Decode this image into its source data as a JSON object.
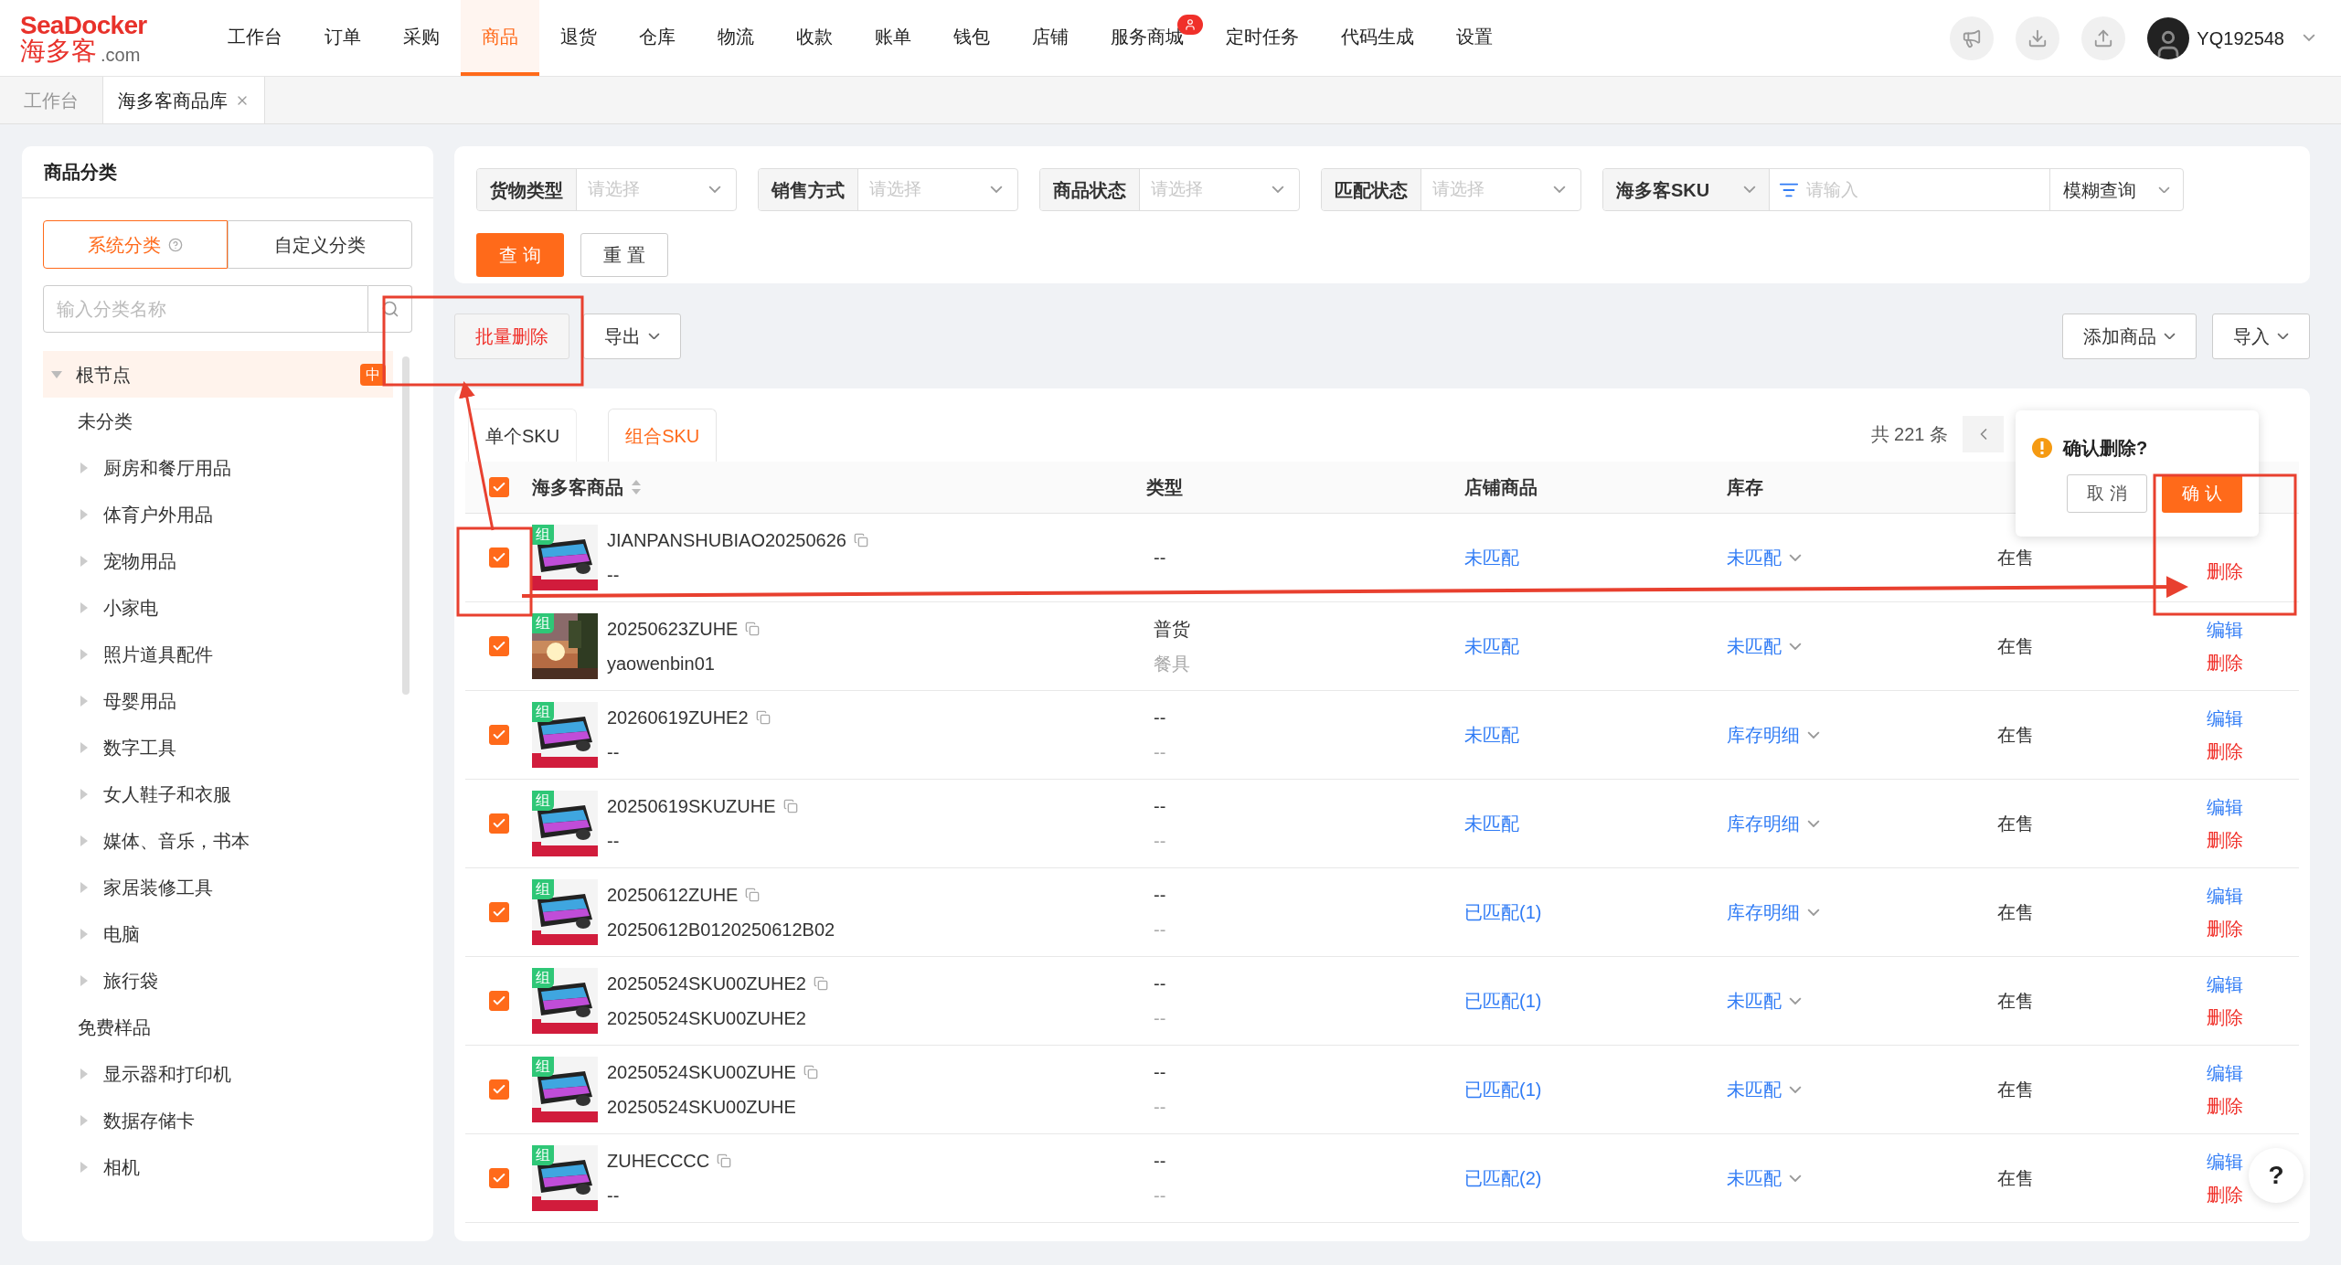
{
  "header": {
    "logo": {
      "brand": "SeaDocker",
      "name": "海多客",
      "suffix": ".com"
    },
    "nav": [
      {
        "label": "工作台",
        "selected": false
      },
      {
        "label": "订单",
        "selected": false
      },
      {
        "label": "采购",
        "selected": false
      },
      {
        "label": "商品",
        "selected": true
      },
      {
        "label": "退货",
        "selected": false
      },
      {
        "label": "仓库",
        "selected": false
      },
      {
        "label": "物流",
        "selected": false
      },
      {
        "label": "收款",
        "selected": false
      },
      {
        "label": "账单",
        "selected": false
      },
      {
        "label": "钱包",
        "selected": false
      },
      {
        "label": "店铺",
        "selected": false
      },
      {
        "label": "服务商城",
        "selected": false,
        "badge": true
      },
      {
        "label": "定时任务",
        "selected": false
      },
      {
        "label": "代码生成",
        "selected": false
      },
      {
        "label": "设置",
        "selected": false
      }
    ],
    "user": "YQ192548"
  },
  "page_tabs": [
    {
      "label": "工作台",
      "selected": false,
      "closable": false
    },
    {
      "label": "海多客商品库",
      "selected": true,
      "closable": true
    }
  ],
  "sidebar": {
    "title": "商品分类",
    "toggle": [
      {
        "label": "系统分类",
        "selected": true,
        "help": true
      },
      {
        "label": "自定义分类",
        "selected": false,
        "help": false
      }
    ],
    "search": {
      "placeholder": "输入分类名称"
    },
    "tree": [
      {
        "label": "根节点",
        "kind": "folder",
        "expanded": true,
        "selected": true,
        "badge": "中",
        "children": [
          {
            "label": "未分类",
            "kind": "leaf",
            "selected": false
          },
          {
            "label": "厨房和餐厅用品",
            "kind": "folder",
            "expanded": false,
            "selected": false
          },
          {
            "label": "体育户外用品",
            "kind": "folder",
            "expanded": false,
            "selected": false
          },
          {
            "label": "宠物用品",
            "kind": "folder",
            "expanded": false,
            "selected": false
          },
          {
            "label": "小家电",
            "kind": "folder",
            "expanded": false,
            "selected": false
          },
          {
            "label": "照片道具配件",
            "kind": "folder",
            "expanded": false,
            "selected": false
          },
          {
            "label": "母婴用品",
            "kind": "folder",
            "expanded": false,
            "selected": false
          },
          {
            "label": "数字工具",
            "kind": "folder",
            "expanded": false,
            "selected": false
          },
          {
            "label": "女人鞋子和衣服",
            "kind": "folder",
            "expanded": false,
            "selected": false
          },
          {
            "label": "媒体、音乐，书本",
            "kind": "folder",
            "expanded": false,
            "selected": false
          },
          {
            "label": "家居装修工具",
            "kind": "folder",
            "expanded": false,
            "selected": false
          },
          {
            "label": "电脑",
            "kind": "folder",
            "expanded": false,
            "selected": false
          },
          {
            "label": "旅行袋",
            "kind": "folder",
            "expanded": false,
            "selected": false
          },
          {
            "label": "免费样品",
            "kind": "leaf",
            "selected": false
          },
          {
            "label": "显示器和打印机",
            "kind": "folder",
            "expanded": false,
            "selected": false
          },
          {
            "label": "数据存储卡",
            "kind": "folder",
            "expanded": false,
            "selected": false
          },
          {
            "label": "相机",
            "kind": "folder",
            "expanded": false,
            "selected": false
          }
        ]
      }
    ]
  },
  "filters": [
    {
      "label": "货物类型",
      "placeholder": "请选择"
    },
    {
      "label": "销售方式",
      "placeholder": "请选择"
    },
    {
      "label": "商品状态",
      "placeholder": "请选择"
    },
    {
      "label": "匹配状态",
      "placeholder": "请选择"
    }
  ],
  "sku_filter": {
    "field": "海多客SKU",
    "placeholder": "请输入",
    "mode": "模糊查询"
  },
  "filter_buttons": {
    "query": "查 询",
    "reset": "重 置"
  },
  "toolbar": {
    "left": [
      {
        "label": "批量删除",
        "danger": true,
        "dropdown": false
      },
      {
        "label": "导出",
        "danger": false,
        "dropdown": true
      }
    ],
    "right": [
      {
        "label": "添加商品",
        "danger": false,
        "dropdown": true
      },
      {
        "label": "导入",
        "danger": false,
        "dropdown": true
      }
    ]
  },
  "table_tabs": [
    {
      "label": "单个SKU",
      "selected": false
    },
    {
      "label": "组合SKU",
      "selected": true
    }
  ],
  "total": "共 221 条",
  "table": {
    "all_checked": true,
    "columns": [
      {
        "label": "海多客商品",
        "sortable": true
      },
      {
        "label": "类型",
        "sortable": false
      },
      {
        "label": "店铺商品",
        "sortable": false
      },
      {
        "label": "库存",
        "sortable": false
      }
    ],
    "rows": [
      {
        "checked": true,
        "badge": "组",
        "sku": "JIANPANSHUBIAO20250626",
        "sub": "--",
        "type": [
          "--"
        ],
        "store": "未匹配",
        "stock": "未匹配",
        "status": "在售",
        "delete": "删除"
      },
      {
        "checked": true,
        "badge": "组",
        "sku": "20250623ZUHE",
        "sub": "yaowenbin01",
        "type": [
          "普货",
          "餐具"
        ],
        "store": "未匹配",
        "stock": "未匹配",
        "status": "在售",
        "edit": "编辑",
        "delete": "删除"
      },
      {
        "checked": true,
        "badge": "组",
        "sku": "20260619ZUHE2",
        "sub": "--",
        "type": [
          "--",
          "--"
        ],
        "store": "未匹配",
        "stock": "库存明细",
        "status": "在售",
        "edit": "编辑",
        "delete": "删除"
      },
      {
        "checked": true,
        "badge": "组",
        "sku": "20250619SKUZUHE",
        "sub": "--",
        "type": [
          "--",
          "--"
        ],
        "store": "未匹配",
        "stock": "库存明细",
        "status": "在售",
        "edit": "编辑",
        "delete": "删除"
      },
      {
        "checked": true,
        "badge": "组",
        "sku": "20250612ZUHE",
        "sub": "20250612B0120250612B02",
        "type": [
          "--",
          "--"
        ],
        "store": "已匹配(1)",
        "stock": "库存明细",
        "status": "在售",
        "edit": "编辑",
        "delete": "删除"
      },
      {
        "checked": true,
        "badge": "组",
        "sku": "20250524SKU00ZUHE2",
        "sub": "20250524SKU00ZUHE2",
        "type": [
          "--",
          "--"
        ],
        "store": "已匹配(1)",
        "stock": "未匹配",
        "status": "在售",
        "edit": "编辑",
        "delete": "删除"
      },
      {
        "checked": true,
        "badge": "组",
        "sku": "20250524SKU00ZUHE",
        "sub": "20250524SKU00ZUHE",
        "type": [
          "--",
          "--"
        ],
        "store": "已匹配(1)",
        "stock": "未匹配",
        "status": "在售",
        "edit": "编辑",
        "delete": "删除"
      },
      {
        "checked": true,
        "badge": "组",
        "sku": "ZUHECCCC",
        "sub": "--",
        "type": [
          "--",
          "--"
        ],
        "store": "已匹配(2)",
        "stock": "未匹配",
        "status": "在售",
        "edit": "编辑",
        "delete": "删除"
      }
    ]
  },
  "popconfirm": {
    "title": "确认删除?",
    "cancel": "取 消",
    "confirm": "确 认"
  },
  "help": "?"
}
